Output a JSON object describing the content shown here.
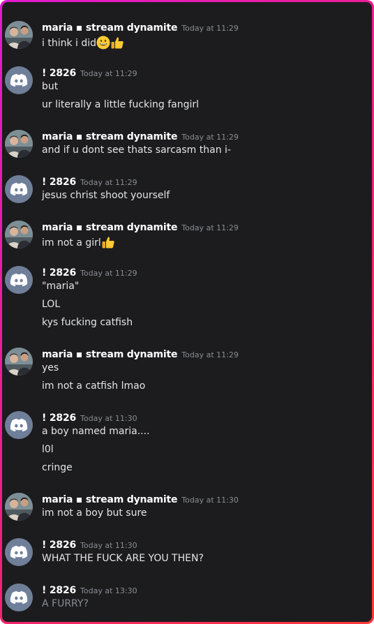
{
  "messages": [
    {
      "author": "maria ▪ stream dynamite",
      "avatar": "photo-avatar",
      "timestamp": "Today at 11:29",
      "lines": [
        "i think i did"
      ],
      "emojis": [
        "grinning-face",
        "thumbs-up"
      ]
    },
    {
      "author": "! 2826",
      "avatar": "discord-avatar",
      "timestamp": "Today at 11:29",
      "lines": [
        "but",
        "ur literally a little fucking fangirl"
      ]
    },
    {
      "author": "maria ▪ stream dynamite",
      "avatar": "photo-avatar",
      "timestamp": "Today at 11:29",
      "lines": [
        "and if u dont see thats sarcasm than i-"
      ]
    },
    {
      "author": "! 2826",
      "avatar": "discord-avatar",
      "timestamp": "Today at 11:29",
      "lines": [
        "jesus christ shoot yourself"
      ]
    },
    {
      "author": "maria ▪ stream dynamite",
      "avatar": "photo-avatar",
      "timestamp": "Today at 11:29",
      "lines": [
        "im not a girl"
      ],
      "emojis": [
        "thumbs-up"
      ]
    },
    {
      "author": "! 2826",
      "avatar": "discord-avatar",
      "timestamp": "Today at 11:29",
      "lines": [
        "\"maria\"",
        "LOL",
        "kys fucking catfish"
      ]
    },
    {
      "author": "maria ▪ stream dynamite",
      "avatar": "photo-avatar",
      "timestamp": "Today at 11:29",
      "lines": [
        "yes",
        "im not a catfish lmao"
      ]
    },
    {
      "author": "! 2826",
      "avatar": "discord-avatar",
      "timestamp": "Today at 11:30",
      "lines": [
        "a boy named maria....",
        "l0l",
        "cringe"
      ]
    },
    {
      "author": "maria ▪ stream dynamite",
      "avatar": "photo-avatar",
      "timestamp": "Today at 11:30",
      "lines": [
        "im not a boy but sure"
      ]
    },
    {
      "author": "! 2826",
      "avatar": "discord-avatar",
      "timestamp": "Today at 11:30",
      "lines": [
        "WHAT THE FUCK ARE YOU THEN?"
      ]
    },
    {
      "author": "! 2826",
      "avatar": "discord-avatar",
      "timestamp": "Today at 13:30",
      "lines": [
        "A FURRY?"
      ],
      "faded_last_line": true
    }
  ],
  "colors": {
    "background": "#1c1c1e",
    "author": "#ffffff",
    "timestamp": "#8a8d93",
    "message_text": "#e4e5e8",
    "discord_avatar": "#6f7f99",
    "frame_gradient_start": "#e11bd0",
    "frame_gradient_end": "#ff3a3a"
  }
}
